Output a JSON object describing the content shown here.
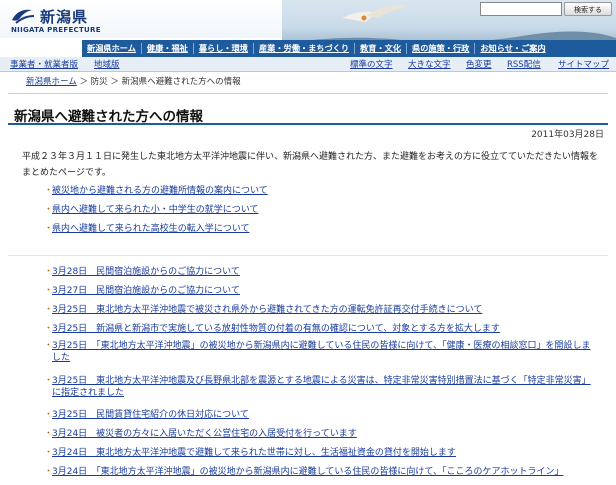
{
  "header": {
    "logo_jp": "新潟県",
    "logo_en": "NIIGATA PREFECTURE",
    "search_button": "検索する"
  },
  "global_nav": [
    "新潟県ホーム",
    "健康・福祉",
    "暮らし・環境",
    "産業・労働・まちづくり",
    "教育・文化",
    "県の施策・行政",
    "お知らせ・ご案内"
  ],
  "sub_nav": {
    "left": [
      "事業者・就業者版",
      "地域版"
    ],
    "right": [
      "標準の文字",
      "大きな文字",
      "色変更",
      "RSS配信",
      "サイトマップ"
    ]
  },
  "breadcrumb": {
    "home": "新潟県ホーム",
    "sep1": " ＞ ",
    "mid": "防災",
    "sep2": " ＞ ",
    "current": "新潟県へ避難された方への情報"
  },
  "page": {
    "title": "新潟県へ避難された方への情報",
    "date": "2011年03月28日",
    "intro": "平成２３年３月１１日に発生した東北地方太平洋沖地震に伴い、新潟県へ避難された方、また避難をお考えの方に役立てていただきたい情報をまとめたページです。"
  },
  "primary_links": [
    "被災地から避難される方の避難所情報の案内について",
    "県内へ避難して来られた小・中学生の就学について",
    "県内へ避難して来られた高校生の転入学について"
  ],
  "news_links": [
    "3月28日　民間宿泊施設からのご協力について",
    "3月27日　民間宿泊施設からのご協力について",
    "3月25日　東北地方太平洋沖地震で被災され県外から避難されてきた方の運転免許証再交付手続きについて",
    "3月25日　新潟県と新潟市で実施している放射性物質の付着の有無の確認について、対象とする方を拡大します",
    "3月25日　「東北地方太平洋沖地震」の被災地から新潟県内に避難している住民の皆様に向けて、「健康・医療の相談窓口」を開設しました",
    "3月25日　東北地方太平洋沖地震及び長野県北部を震源とする地震による災害は、特定非常災害特別措置法に基づく「特定非常災害」に指定されました",
    "3月25日　民間賃貸住宅紹介の休日対応について",
    "3月24日　被災者の方々に入居いただく公営住宅の入居受付を行っています",
    "3月24日　東北地方太平洋沖地震で避難して来られた世帯に対し、生活福祉資金の貸付を開始します",
    "3月24日　「東北地方太平洋沖地震」の被災地から新潟県内に避難している住民の皆様に向けて、「こころのケアホットライン」"
  ]
}
